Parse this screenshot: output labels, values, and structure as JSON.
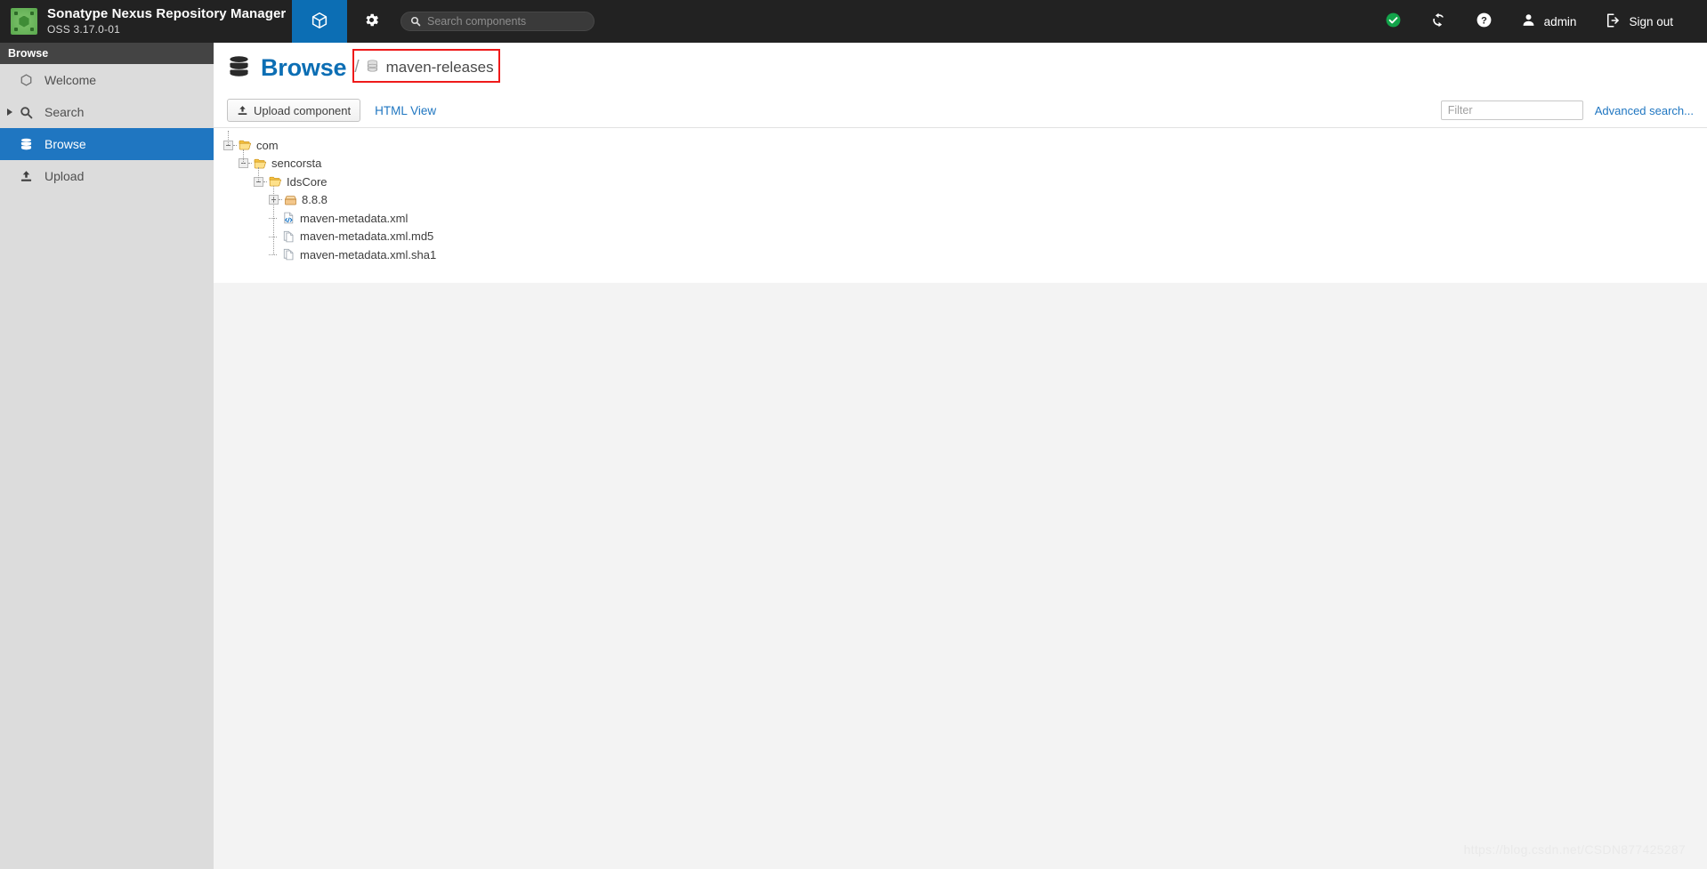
{
  "header": {
    "brand_title": "Sonatype Nexus Repository Manager",
    "brand_version": "OSS 3.17.0-01",
    "logo_icon": "nexus-cube-logo-icon",
    "mode_tab_icon": "cube-icon",
    "settings_icon": "gear-icon",
    "search": {
      "icon": "search-icon",
      "placeholder": "Search components",
      "value": ""
    },
    "status": {
      "icon": "status-ok-check-icon",
      "color": "#13a34a"
    },
    "refresh": {
      "icon": "refresh-sync-icon"
    },
    "help": {
      "icon": "help-question-icon"
    },
    "user": {
      "icon": "user-avatar-icon",
      "label": "admin"
    },
    "signout": {
      "icon": "sign-out-icon",
      "label": "Sign out"
    }
  },
  "sidebar": {
    "title": "Browse",
    "items": [
      {
        "label": "Welcome",
        "icon": "hexagon-icon",
        "selected": false,
        "expandable": false
      },
      {
        "label": "Search",
        "icon": "search-icon",
        "selected": false,
        "expandable": true
      },
      {
        "label": "Browse",
        "icon": "database-icon",
        "selected": true,
        "expandable": false
      },
      {
        "label": "Upload",
        "icon": "upload-icon",
        "selected": false,
        "expandable": false
      }
    ]
  },
  "page": {
    "title": "Browse",
    "title_icon": "database-icon",
    "breadcrumb_separator": "/",
    "repository": {
      "name": "maven-releases",
      "icon": "database-icon"
    },
    "highlight_color": "#ef1a1a"
  },
  "toolbar": {
    "upload_label": "Upload component",
    "upload_icon": "upload-icon",
    "html_view_label": "HTML View",
    "filter_placeholder": "Filter",
    "filter_value": "",
    "advanced_search_label": "Advanced search..."
  },
  "tree": {
    "nodes": [
      {
        "label": "com",
        "depth": 0,
        "icon": "folder-open-icon",
        "toggle": "minus"
      },
      {
        "label": "sencorsta",
        "depth": 1,
        "icon": "folder-open-icon",
        "toggle": "minus"
      },
      {
        "label": "IdsCore",
        "depth": 2,
        "icon": "folder-open-icon",
        "toggle": "minus"
      },
      {
        "label": "8.8.8",
        "depth": 3,
        "icon": "package-box-icon",
        "toggle": "plus"
      },
      {
        "label": "maven-metadata.xml",
        "depth": 3,
        "icon": "xml-file-icon",
        "toggle": "none"
      },
      {
        "label": "maven-metadata.xml.md5",
        "depth": 3,
        "icon": "file-copy-icon",
        "toggle": "none"
      },
      {
        "label": "maven-metadata.xml.sha1",
        "depth": 3,
        "icon": "file-copy-icon",
        "toggle": "none"
      }
    ]
  },
  "watermark": {
    "text": "https://blog.csdn.net/CSDN877425287"
  }
}
